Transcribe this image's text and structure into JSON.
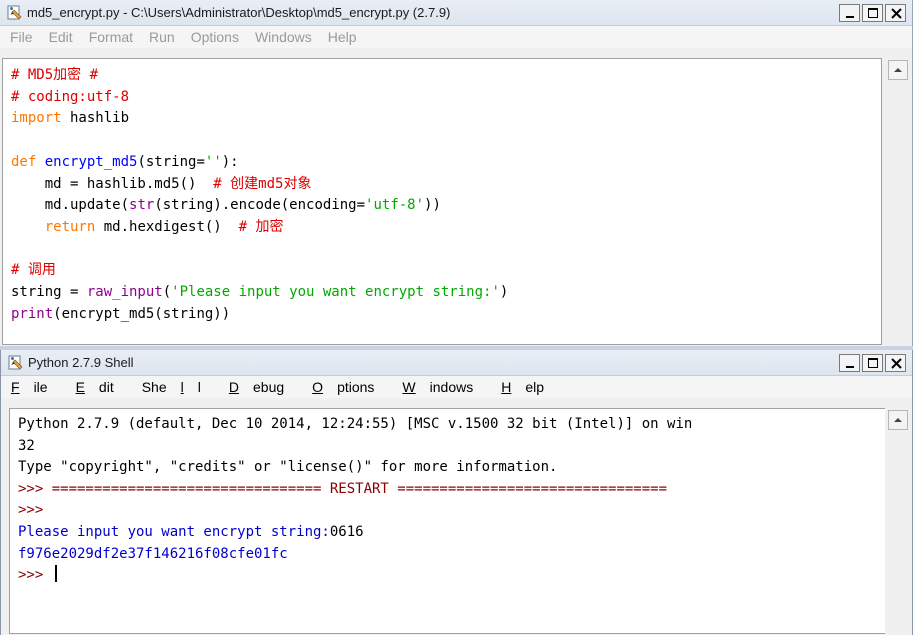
{
  "editor": {
    "title": "md5_encrypt.py - C:\\Users\\Administrator\\Desktop\\md5_encrypt.py (2.7.9)",
    "menu": [
      "File",
      "Edit",
      "Format",
      "Run",
      "Options",
      "Windows",
      "Help"
    ],
    "code": {
      "l1": "# MD5加密 #",
      "l2": "# coding:utf-8",
      "l3_kw": "import",
      "l3_rest": " hashlib",
      "l5_kw": "def",
      "l5_fn": "encrypt_md5",
      "l5_a": "(string=",
      "l5_str": "''",
      "l5_b": "):",
      "l6_code": "    md = hashlib.md5()  ",
      "l6_cm": "# 创建md5对象",
      "l7_a": "    md.update(",
      "l7_bi": "str",
      "l7_b": "(string).encode(encoding=",
      "l7_str": "'utf-8'",
      "l7_c": "))",
      "l8_indent": "    ",
      "l8_kw": "return",
      "l8_code": " md.hexdigest()  ",
      "l8_cm": "# 加密",
      "l10": "# 调用",
      "l11_a": "string = ",
      "l11_bi": "raw_input",
      "l11_b": "(",
      "l11_str": "'Please input you want encrypt string:'",
      "l11_c": ")",
      "l12_kw": "print",
      "l12_rest": "(encrypt_md5(string))"
    }
  },
  "shell": {
    "title": "Python 2.7.9 Shell",
    "menu": [
      {
        "u": "F",
        "rest": "ile"
      },
      {
        "u": "E",
        "rest": "dit"
      },
      {
        "pre": "She",
        "u": "l",
        "rest": "l"
      },
      {
        "u": "D",
        "rest": "ebug"
      },
      {
        "u": "O",
        "rest": "ptions"
      },
      {
        "u": "W",
        "rest": "indows"
      },
      {
        "u": "H",
        "rest": "elp"
      }
    ],
    "lines": {
      "banner1": "Python 2.7.9 (default, Dec 10 2014, 12:24:55) [MSC v.1500 32 bit (Intel)] on win",
      "banner2": "32",
      "banner3": "Type \"copyright\", \"credits\" or \"license()\" for more information.",
      "restart": ">>> ================================ RESTART ================================",
      "prompt1": ">>>",
      "input_prompt": "Please input you want encrypt string:",
      "input_value": "0616",
      "output": "f976e2029df2e37f146216f08cfe01fc",
      "prompt2": ">>> "
    }
  },
  "colors": {
    "keyword": "#ff7700",
    "comment": "#dd0000",
    "string": "#00aa00",
    "builtin": "#900090",
    "definition": "#0000ff",
    "stdout": "#0000cc",
    "prompt": "#8b0000"
  },
  "icons": {
    "app": "idle-python-icon",
    "minimize": "minimize-icon",
    "maximize": "maximize-icon",
    "close": "close-icon",
    "scroll_up": "scroll-up-arrow-icon"
  }
}
